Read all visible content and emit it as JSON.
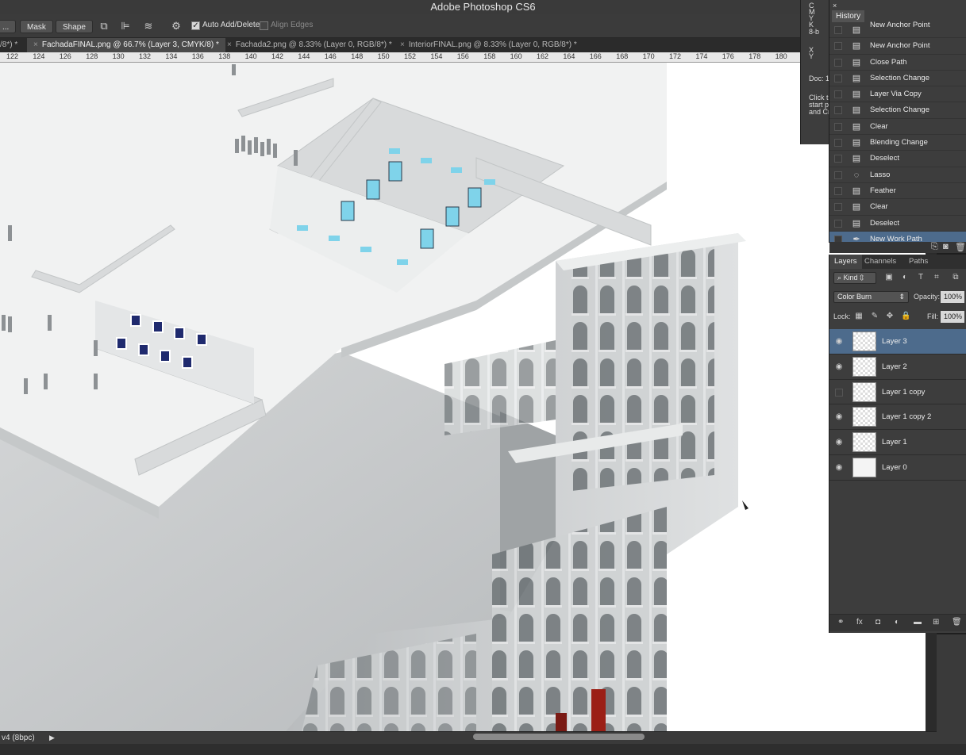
{
  "app": {
    "title": "Adobe Photoshop CS6"
  },
  "options_bar": {
    "mask_label": "Mask",
    "shape_label": "Shape",
    "auto_add_delete_label": "Auto Add/Delete",
    "auto_add_delete_checked": true,
    "align_edges_label": "Align Edges",
    "align_edges_checked": false,
    "truncated_button_label": "..."
  },
  "document_tabs": [
    {
      "label": "/8*) *",
      "active": false
    },
    {
      "label": "FachadaFINAL.png @ 66.7% (Layer 3, CMYK/8) *",
      "active": true
    },
    {
      "label": "Fachada2.png @ 8.33% (Layer 0, RGB/8*) *",
      "active": false
    },
    {
      "label": "InteriorFINAL.png @ 8.33% (Layer 0, RGB/8*) *",
      "active": false
    }
  ],
  "ruler_ticks": [
    "122",
    "124",
    "126",
    "128",
    "130",
    "132",
    "134",
    "136",
    "138",
    "140",
    "142",
    "144",
    "146",
    "148",
    "150",
    "152",
    "154",
    "156",
    "158",
    "160",
    "162",
    "164",
    "166",
    "168",
    "170",
    "172",
    "174",
    "176",
    "178",
    "180"
  ],
  "status_bar": {
    "doc_info": "v4 (8bpc)"
  },
  "info_panel": {
    "lines": [
      "C",
      "M",
      "Y",
      "K",
      "8-b",
      "X",
      "Y",
      "Doc: 1",
      "Click t",
      "start p",
      "and Cr"
    ]
  },
  "history": {
    "title": "History",
    "items": [
      {
        "label": "New Anchor Point",
        "icon": "history-state-icon",
        "selected": false,
        "clipped": true
      },
      {
        "label": "New Anchor Point",
        "icon": "history-state-icon",
        "selected": false
      },
      {
        "label": "Close Path",
        "icon": "history-state-icon",
        "selected": false
      },
      {
        "label": "Selection Change",
        "icon": "history-state-icon",
        "selected": false
      },
      {
        "label": "Layer Via Copy",
        "icon": "history-state-icon",
        "selected": false
      },
      {
        "label": "Selection Change",
        "icon": "history-state-icon",
        "selected": false
      },
      {
        "label": "Clear",
        "icon": "history-state-icon",
        "selected": false
      },
      {
        "label": "Blending Change",
        "icon": "history-state-icon",
        "selected": false
      },
      {
        "label": "Deselect",
        "icon": "history-state-icon",
        "selected": false
      },
      {
        "label": "Lasso",
        "icon": "lasso-icon",
        "selected": false
      },
      {
        "label": "Feather",
        "icon": "history-state-icon",
        "selected": false
      },
      {
        "label": "Clear",
        "icon": "history-state-icon",
        "selected": false
      },
      {
        "label": "Deselect",
        "icon": "history-state-icon",
        "selected": false
      },
      {
        "label": "New Work Path",
        "icon": "pen-icon",
        "selected": true
      }
    ]
  },
  "layers_panel": {
    "tabs": [
      {
        "label": "Layers",
        "active": true
      },
      {
        "label": "Channels",
        "active": false
      },
      {
        "label": "Paths",
        "active": false
      }
    ],
    "filter_kind": "Kind",
    "blend_mode": "Color Burn",
    "opacity_label": "Opacity:",
    "opacity_value": "100%",
    "lock_label": "Lock:",
    "fill_label": "Fill:",
    "fill_value": "100%",
    "layers": [
      {
        "name": "Layer 3",
        "visible": true,
        "selected": true,
        "thumb": "transparent"
      },
      {
        "name": "Layer 2",
        "visible": true,
        "selected": false,
        "thumb": "transparent"
      },
      {
        "name": "Layer 1 copy",
        "visible": false,
        "selected": false,
        "thumb": "transparent"
      },
      {
        "name": "Layer 1 copy 2",
        "visible": true,
        "selected": false,
        "thumb": "transparent"
      },
      {
        "name": "Layer 1",
        "visible": true,
        "selected": false,
        "thumb": "transparent"
      },
      {
        "name": "Layer 0",
        "visible": true,
        "selected": false,
        "thumb": "image"
      }
    ]
  },
  "colors": {
    "selection_blue": "#4d6b8c",
    "panel_bg": "#3d3d3d",
    "canvas_bg": "#ffffff",
    "display_case_cyan": "#7fd3ea"
  }
}
